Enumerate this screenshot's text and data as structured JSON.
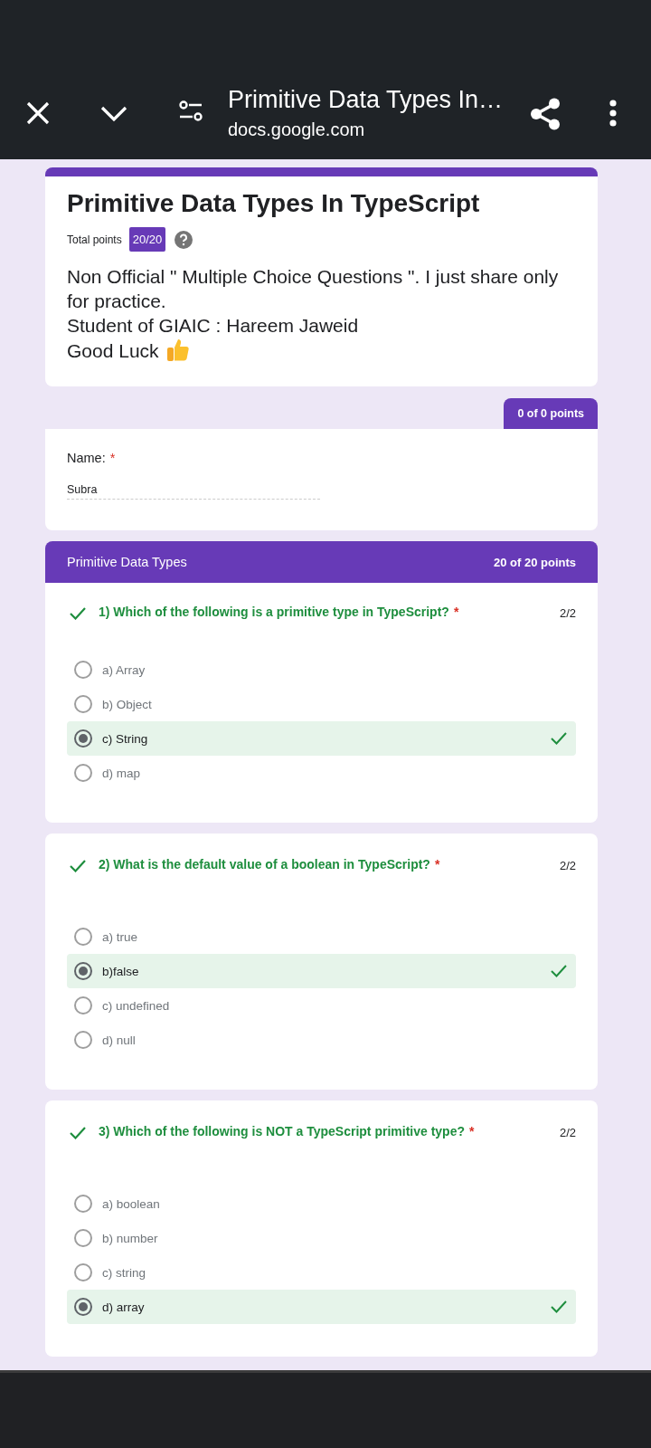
{
  "browser_bar": {
    "title": "Primitive Data Types In…",
    "url": "docs.google.com"
  },
  "form": {
    "title": "Primitive Data Types In TypeScript",
    "total_points_label": "Total points",
    "total_points": "20/20",
    "description": [
      "Non Official \" Multiple Choice Questions \". I just share only for practice.",
      "Student of GIAIC : Hareem Jaweid",
      "Good Luck"
    ]
  },
  "name_section": {
    "points": "0 of 0 points",
    "label": "Name:",
    "required_mark": "*",
    "value": "Subra"
  },
  "section": {
    "title": "Primitive Data Types",
    "points": "20 of 20 points"
  },
  "questions": [
    {
      "title": "1) Which of the following is a primitive type in TypeScript?",
      "required_mark": "*",
      "correct": true,
      "score": "2/2",
      "options": [
        {
          "label": "a) Array",
          "selected": false
        },
        {
          "label": "b) Object",
          "selected": false
        },
        {
          "label": "c) String",
          "selected": true
        },
        {
          "label": "d) map",
          "selected": false
        }
      ]
    },
    {
      "title": "2) What is the default value of a boolean in TypeScript?",
      "required_mark": "*",
      "correct": true,
      "score": "2/2",
      "options": [
        {
          "label": "a) true",
          "selected": false
        },
        {
          "label": "b)false",
          "selected": true
        },
        {
          "label": "c) undefined",
          "selected": false
        },
        {
          "label": "d) null",
          "selected": false
        }
      ]
    },
    {
      "title": "3) Which of the following is NOT a TypeScript primitive type?",
      "required_mark": "*",
      "correct": true,
      "score": "2/2",
      "options": [
        {
          "label": "a) boolean",
          "selected": false
        },
        {
          "label": "b) number",
          "selected": false
        },
        {
          "label": "c) string",
          "selected": false
        },
        {
          "label": "d) array",
          "selected": true
        }
      ]
    }
  ]
}
